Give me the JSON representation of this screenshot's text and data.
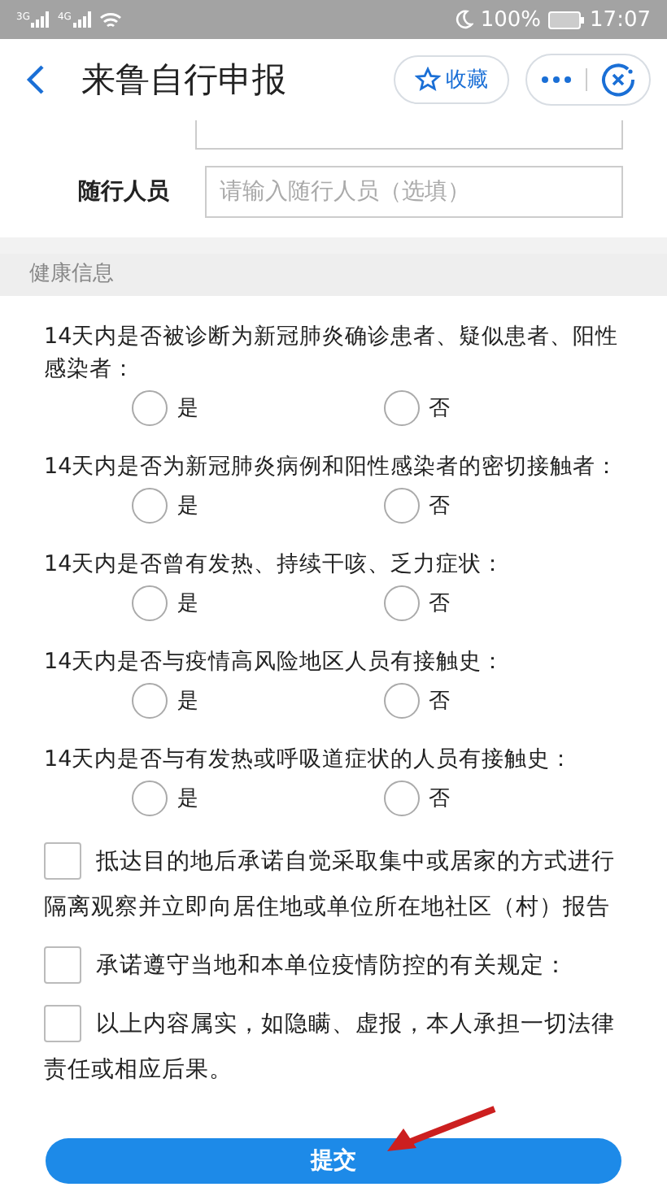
{
  "status_bar": {
    "networks": [
      "3G",
      "4G"
    ],
    "battery": "100%",
    "time": "17:07"
  },
  "nav": {
    "title": "来鲁自行申报",
    "favorite": "收藏"
  },
  "fields": [
    {
      "label": "随行人员",
      "placeholder": "请输入随行人员（选填）"
    }
  ],
  "section": {
    "title": "健康信息"
  },
  "questions": [
    {
      "text": "14天内是否被诊断为新冠肺炎确诊患者、疑似患者、阳性感染者：",
      "options": [
        {
          "label": "是",
          "selected": false
        },
        {
          "label": "否",
          "selected": false
        }
      ]
    },
    {
      "text": "14天内是否为新冠肺炎病例和阳性感染者的密切接触者：",
      "options": [
        {
          "label": "是",
          "selected": false
        },
        {
          "label": "否",
          "selected": false
        }
      ]
    },
    {
      "text": "14天内是否曾有发热、持续干咳、乏力症状：",
      "options": [
        {
          "label": "是",
          "selected": false
        },
        {
          "label": "否",
          "selected": false
        }
      ]
    },
    {
      "text": "14天内是否与疫情高风险地区人员有接触史：",
      "options": [
        {
          "label": "是",
          "selected": false
        },
        {
          "label": "否",
          "selected": false
        }
      ]
    },
    {
      "text": "14天内是否与有发热或呼吸道症状的人员有接触史：",
      "options": [
        {
          "label": "是",
          "selected": false
        },
        {
          "label": "否",
          "selected": false
        }
      ]
    }
  ],
  "pledges": [
    {
      "text": "抵达目的地后承诺自觉采取集中或居家的方式进行隔离观察并立即向居住地或单位所在地社区（村）报告",
      "checked": false
    },
    {
      "text": "承诺遵守当地和本单位疫情防控的有关规定：",
      "checked": false
    },
    {
      "text": "以上内容属实，如隐瞒、虚报，本人承担一切法律责任或相应后果。",
      "checked": false
    }
  ],
  "submit": "提交"
}
